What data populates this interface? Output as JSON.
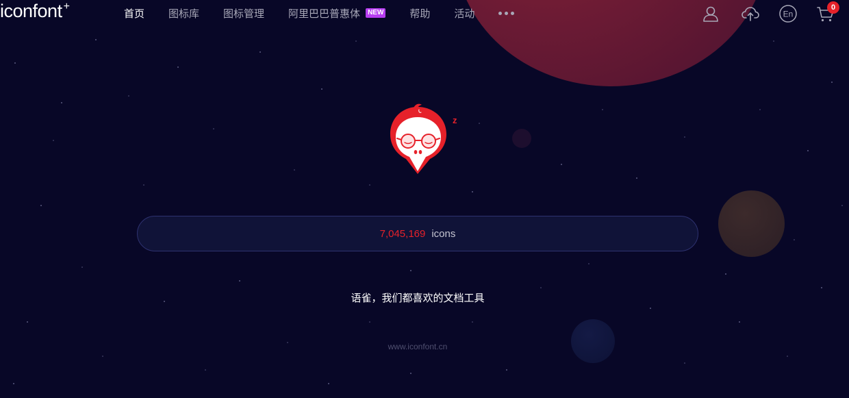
{
  "brand": {
    "logo_text": "iconfont",
    "logo_mark": "+"
  },
  "nav": {
    "items": [
      {
        "label": "首页",
        "active": true
      },
      {
        "label": "图标库",
        "active": false
      },
      {
        "label": "图标管理",
        "active": false
      },
      {
        "label": "阿里巴巴普惠体",
        "active": false,
        "badge": "NEW"
      },
      {
        "label": "帮助",
        "active": false
      },
      {
        "label": "活动",
        "active": false
      }
    ],
    "more_icon": "more-dots-icon"
  },
  "header_actions": {
    "user_icon": "user-icon",
    "upload_icon": "cloud-upload-icon",
    "language_label": "En",
    "cart_icon": "cart-icon",
    "cart_count": "0"
  },
  "hero": {
    "mascot_icon": "sleeping-mascot-icon",
    "sleep_mark": "z"
  },
  "search": {
    "icon_count": "7,045,169",
    "icon_unit": "icons"
  },
  "promo": {
    "tagline": "语雀，我们都喜欢的文档工具"
  },
  "footer": {
    "site_url": "www.iconfont.cn"
  },
  "colors": {
    "background": "#080727",
    "accent_red": "#e6212a",
    "badge_purple": "#b73ef1",
    "nav_text": "#a8a8b8",
    "search_border": "#2e3270"
  }
}
